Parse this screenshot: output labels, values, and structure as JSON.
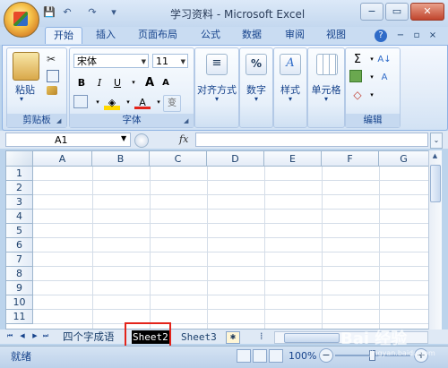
{
  "window": {
    "title": "学习资料 - Microsoft Excel",
    "minimize_icon": "−",
    "restore_icon": "▭",
    "close_icon": "✕"
  },
  "quick_access": {
    "save": "💾",
    "undo": "↶",
    "redo": "↷",
    "more": "▾"
  },
  "ribbon": {
    "tabs": [
      {
        "label": "开始",
        "active": true
      },
      {
        "label": "插入"
      },
      {
        "label": "页面布局"
      },
      {
        "label": "公式"
      },
      {
        "label": "数据"
      },
      {
        "label": "审阅"
      },
      {
        "label": "视图"
      }
    ],
    "help_icon": "?",
    "groups": {
      "clipboard": {
        "label": "剪贴板",
        "paste": "粘贴"
      },
      "font": {
        "label": "字体",
        "font_name": "宋体",
        "font_size": "11",
        "bold": "B",
        "italic": "I",
        "underline": "U",
        "grow": "A",
        "shrink": "A",
        "phonetic": "变"
      },
      "alignment": {
        "label": "对齐方式"
      },
      "number": {
        "label": "数字",
        "icon_text": "%"
      },
      "styles": {
        "label": "样式",
        "icon_text": "A"
      },
      "cells": {
        "label": "单元格"
      },
      "editing": {
        "label": "编辑",
        "sigma": "Σ",
        "sort": "A↓",
        "find": "A"
      }
    }
  },
  "formula_bar": {
    "name_box": "A1",
    "fx": "fx",
    "value": ""
  },
  "grid": {
    "columns": [
      "A",
      "B",
      "C",
      "D",
      "E",
      "F",
      "G"
    ],
    "rows": [
      "1",
      "2",
      "3",
      "4",
      "5",
      "6",
      "7",
      "8",
      "9",
      "10",
      "11"
    ]
  },
  "sheets": {
    "tabs": [
      {
        "label": "四个字成语"
      },
      {
        "label": "Sheet2",
        "editing": true
      },
      {
        "label": "Sheet3"
      }
    ]
  },
  "status_bar": {
    "text": "就绪",
    "zoom": "100%"
  },
  "watermark": {
    "text": "Bai 经验",
    "sub": "jingyan.baidu.com"
  },
  "colors": {
    "accent": "#15428b",
    "highlight_box": "#e3241b"
  }
}
